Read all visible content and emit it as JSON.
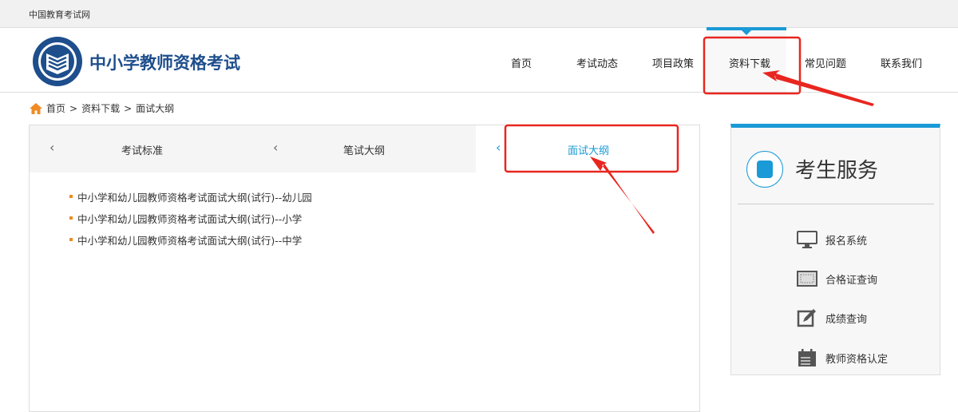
{
  "topbar": {
    "site_link": "中国教育考试网"
  },
  "header": {
    "title": "中小学教师资格考试"
  },
  "nav": {
    "items": [
      "首页",
      "考试动态",
      "项目政策",
      "资料下载",
      "常见问题",
      "联系我们"
    ],
    "active": "资料下载"
  },
  "breadcrumb": {
    "items": [
      "首页",
      "资料下载",
      "面试大纲"
    ],
    "separator": ">"
  },
  "tabs": {
    "items": [
      "考试标准",
      "笔试大纲",
      "面试大纲"
    ],
    "active": "面试大纲"
  },
  "documents": [
    "中小学和幼儿园教师资格考试面试大纲(试行)--幼儿园",
    "中小学和幼儿园教师资格考试面试大纲(试行)--小学",
    "中小学和幼儿园教师资格考试面试大纲(试行)--中学"
  ],
  "services": {
    "title": "考生服务",
    "items": [
      {
        "label": "报名系统",
        "icon": "monitor-icon"
      },
      {
        "label": "合格证查询",
        "icon": "certificate-icon"
      },
      {
        "label": "成绩查询",
        "icon": "edit-icon"
      },
      {
        "label": "教师资格认定",
        "icon": "calendar-icon"
      }
    ]
  },
  "colors": {
    "accent": "#1a9ad6",
    "brand": "#1e4e8c",
    "bullet": "#f08a24",
    "annotation": "#e8261f"
  }
}
